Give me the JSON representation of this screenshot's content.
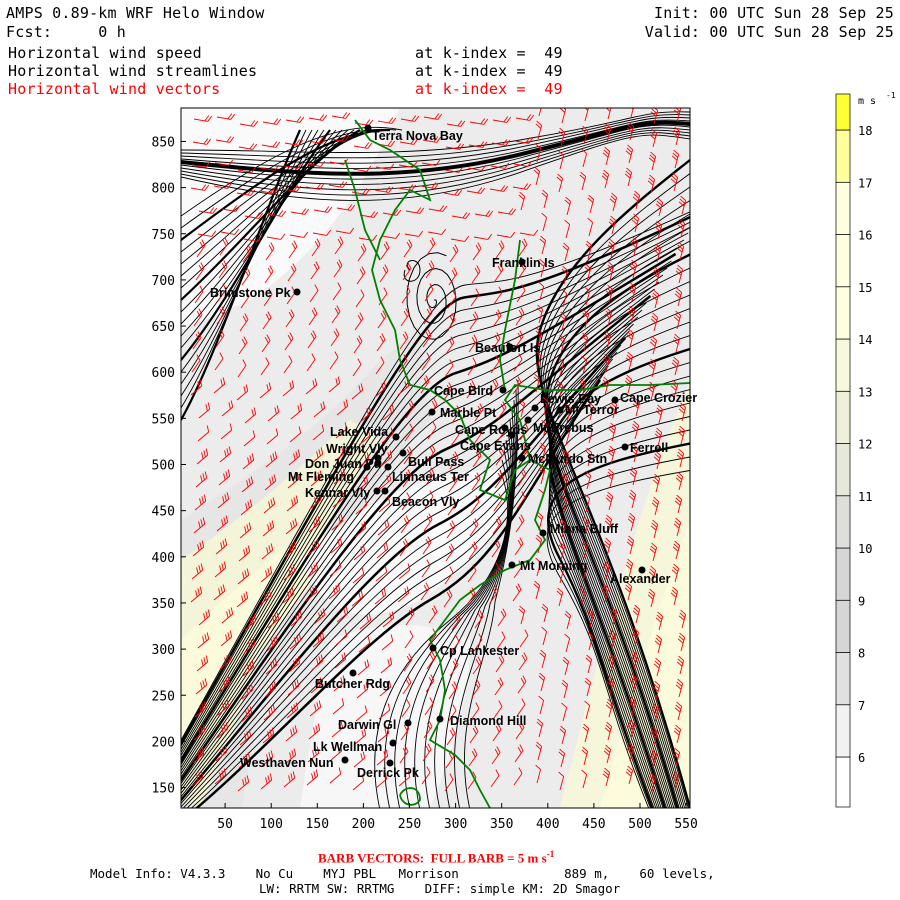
{
  "header": {
    "title": "AMPS 0.89-km WRF Helo Window",
    "fcst": "Fcst:     0 h",
    "init": "Init: 00 UTC Sun 28 Sep 25",
    "valid": "Valid: 00 UTC Sun 28 Sep 25",
    "fields": [
      {
        "name": "Horizontal wind speed",
        "level": "at k-index =  49"
      },
      {
        "name": "Horizontal wind streamlines",
        "level": "at k-index =  49"
      },
      {
        "name": "Horizontal wind vectors",
        "level": "at k-index =  49"
      }
    ]
  },
  "footer": {
    "barb_note": "BARB VECTORS:  FULL BARB = 5 m s",
    "barb_exp": "-1",
    "model_line1": "Model Info: V4.3.3    No Cu    MYJ PBL   Morrison              889 m,    60 levels,",
    "model_line2": "LW: RRTM SW: RRTMG    DIFF: simple KM: 2D Smagor"
  },
  "colors": {
    "barb": "#ff0000",
    "coast": "#008000",
    "streamline": "#000000"
  },
  "chart_data": {
    "type": "heatmap",
    "title": "Horizontal wind speed / streamlines / vectors at k-index 49",
    "xlim": [
      0,
      560
    ],
    "ylim": [
      125,
      885
    ],
    "xticks": [
      50,
      100,
      150,
      200,
      250,
      300,
      350,
      400,
      450,
      500,
      550
    ],
    "yticks": [
      150,
      200,
      250,
      300,
      350,
      400,
      450,
      500,
      550,
      600,
      650,
      700,
      750,
      800,
      850
    ],
    "colorbar": {
      "unit": "m s",
      "unit_exp": "-1",
      "levels": [
        6,
        7,
        8,
        9,
        10,
        11,
        12,
        13,
        14,
        15,
        16,
        17,
        18
      ],
      "colors": [
        "#ffffff",
        "#f2f2f2",
        "#e0e0e0",
        "#d6d6d6",
        "#d6d6d6",
        "#dededa",
        "#e6e8da",
        "#f0f0da",
        "#f8f8dc",
        "#ffffe0",
        "#ffffe0",
        "#ffffe0",
        "#ffff9c",
        "#ffff33"
      ]
    },
    "stations": [
      "Terra Nova Bay",
      "Franklin Is",
      "Brimstone Pk",
      "Beaufort Is",
      "Cape Bird",
      "Marble Pt",
      "Lake Vida",
      "Wright Vly",
      "Bull Pass",
      "Don Juan Pd",
      "Mt Fleming",
      "Linnaeus Ter",
      "Kennar Vly",
      "Beacon Vly",
      "Cape Royds",
      "Cape Evans",
      "McMurdo Stn",
      "Lewis Bay",
      "Mt Terror",
      "Cape Crozier",
      "Mt Erebus",
      "Ferrell",
      "Minna Bluff",
      "Mt Morning",
      "Alexander",
      "Cp Lankester",
      "Butcher Rdg",
      "Darwin Gl",
      "Diamond Hill",
      "Lk Wellman",
      "Westhaven Nun",
      "Derrick Pk"
    ]
  }
}
